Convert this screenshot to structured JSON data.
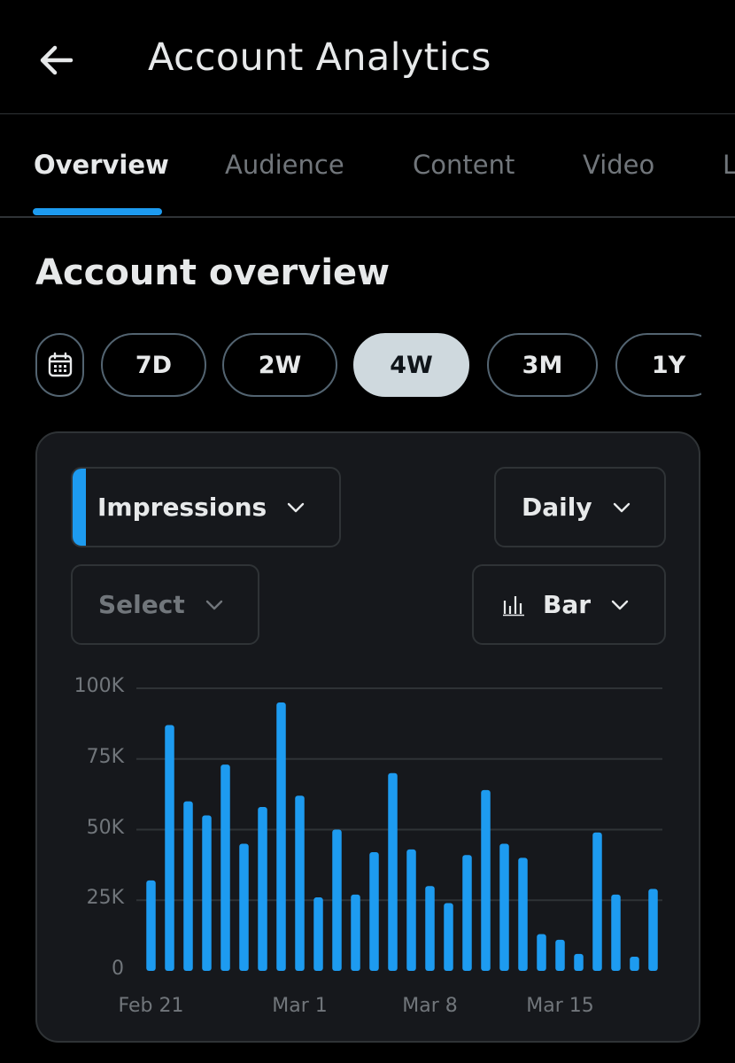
{
  "header": {
    "title": "Account Analytics",
    "back_icon": "arrow-left-icon"
  },
  "tabs": [
    {
      "label": "Overview",
      "active": true
    },
    {
      "label": "Audience",
      "active": false
    },
    {
      "label": "Content",
      "active": false
    },
    {
      "label": "Video",
      "active": false
    },
    {
      "label": "L",
      "active": false
    }
  ],
  "section": {
    "title": "Account overview"
  },
  "ranges": {
    "calendar_icon": "calendar-icon",
    "options": [
      {
        "label": "7D",
        "selected": false
      },
      {
        "label": "2W",
        "selected": false
      },
      {
        "label": "4W",
        "selected": true
      },
      {
        "label": "3M",
        "selected": false
      },
      {
        "label": "1Y",
        "selected": false
      }
    ]
  },
  "controls": {
    "metric": {
      "label": "Impressions",
      "icon": "chevron-down-icon"
    },
    "interval": {
      "label": "Daily",
      "icon": "chevron-down-icon"
    },
    "compare": {
      "label": "Select",
      "icon": "chevron-down-icon"
    },
    "chart_type": {
      "label": "Bar",
      "icon": "bar-chart-icon"
    }
  },
  "colors": {
    "accent": "#1d9bf0",
    "background": "#000000",
    "card": "#16181c",
    "muted_text": "#71767b"
  },
  "chart_data": {
    "type": "bar",
    "grid": true,
    "ylim": [
      0,
      100000
    ],
    "y_ticks": [
      {
        "value": 0,
        "label": "0"
      },
      {
        "value": 25000,
        "label": "25K"
      },
      {
        "value": 50000,
        "label": "50K"
      },
      {
        "value": 75000,
        "label": "75K"
      },
      {
        "value": 100000,
        "label": "100K"
      }
    ],
    "x_ticks": [
      {
        "index": 0,
        "label": "Feb 21"
      },
      {
        "index": 8,
        "label": "Mar 1"
      },
      {
        "index": 15,
        "label": "Mar 8"
      },
      {
        "index": 22,
        "label": "Mar 15"
      }
    ],
    "series": [
      {
        "values": [
          32000,
          87000,
          60000,
          55000,
          73000,
          45000,
          58000,
          95000,
          62000,
          26000,
          50000,
          27000,
          42000,
          70000,
          43000,
          30000,
          24000,
          41000,
          64000,
          45000,
          40000,
          13000,
          11000,
          6000,
          49000,
          27000,
          5000,
          29000
        ]
      }
    ]
  }
}
